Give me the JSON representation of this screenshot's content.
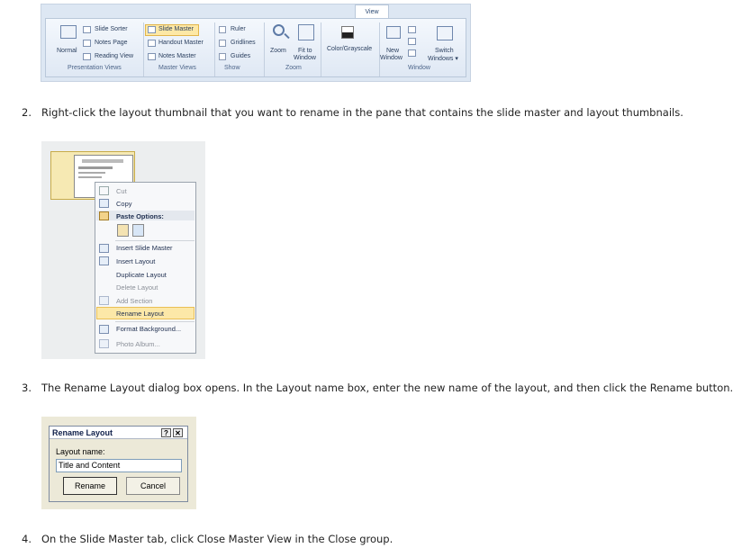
{
  "ribbon": {
    "tab_view": "View",
    "items": {
      "normal": "Normal",
      "slide_sorter": "Slide Sorter",
      "notes_page": "Notes Page",
      "reading_view": "Reading View",
      "slide_master": "Slide Master",
      "handout_master": "Handout Master",
      "notes_master": "Notes Master",
      "ruler": "Ruler",
      "gridlines": "Gridlines",
      "guides": "Guides",
      "zoom": "Zoom",
      "fit_to": "Fit to",
      "window_label": "Window",
      "color_grayscale": "Color/Grayscale",
      "new": "New",
      "new_window": "Window",
      "switch": "Switch",
      "switch_windows": "Windows ▾"
    },
    "groups": {
      "presentation_views": "Presentation Views",
      "master_views": "Master Views",
      "show": "Show",
      "zoom": "Zoom",
      "window": "Window"
    }
  },
  "steps": [
    {
      "num": "2.",
      "text": "Right-click the layout thumbnail that you want to rename in the pane that contains the slide master and layout thumbnails."
    },
    {
      "num": "3.",
      "text": "The Rename Layout dialog box opens. In the Layout name box, enter the new name of the layout, and then click the Rename button."
    },
    {
      "num": "4.",
      "text": "On the Slide Master tab, click Close Master View in the Close group."
    }
  ],
  "context_menu": {
    "cut": "Cut",
    "copy": "Copy",
    "paste_options": "Paste Options:",
    "insert_slide_master": "Insert Slide Master",
    "insert_layout": "Insert Layout",
    "duplicate_layout": "Duplicate Layout",
    "delete_layout": "Delete Layout",
    "add_section": "Add Section",
    "rename_layout": "Rename Layout",
    "format_background": "Format Background...",
    "photo_album": "Photo Album..."
  },
  "dialog": {
    "title": "Rename Layout",
    "help": "?",
    "close": "✕",
    "field_label": "Layout name:",
    "field_value": "Title and Content",
    "rename_button": "Rename",
    "cancel_button": "Cancel"
  },
  "colors": {
    "highlight": "#fde8a6",
    "ribbon_bg": "#dde7f3",
    "dialog_bg": "#ece9d8"
  }
}
